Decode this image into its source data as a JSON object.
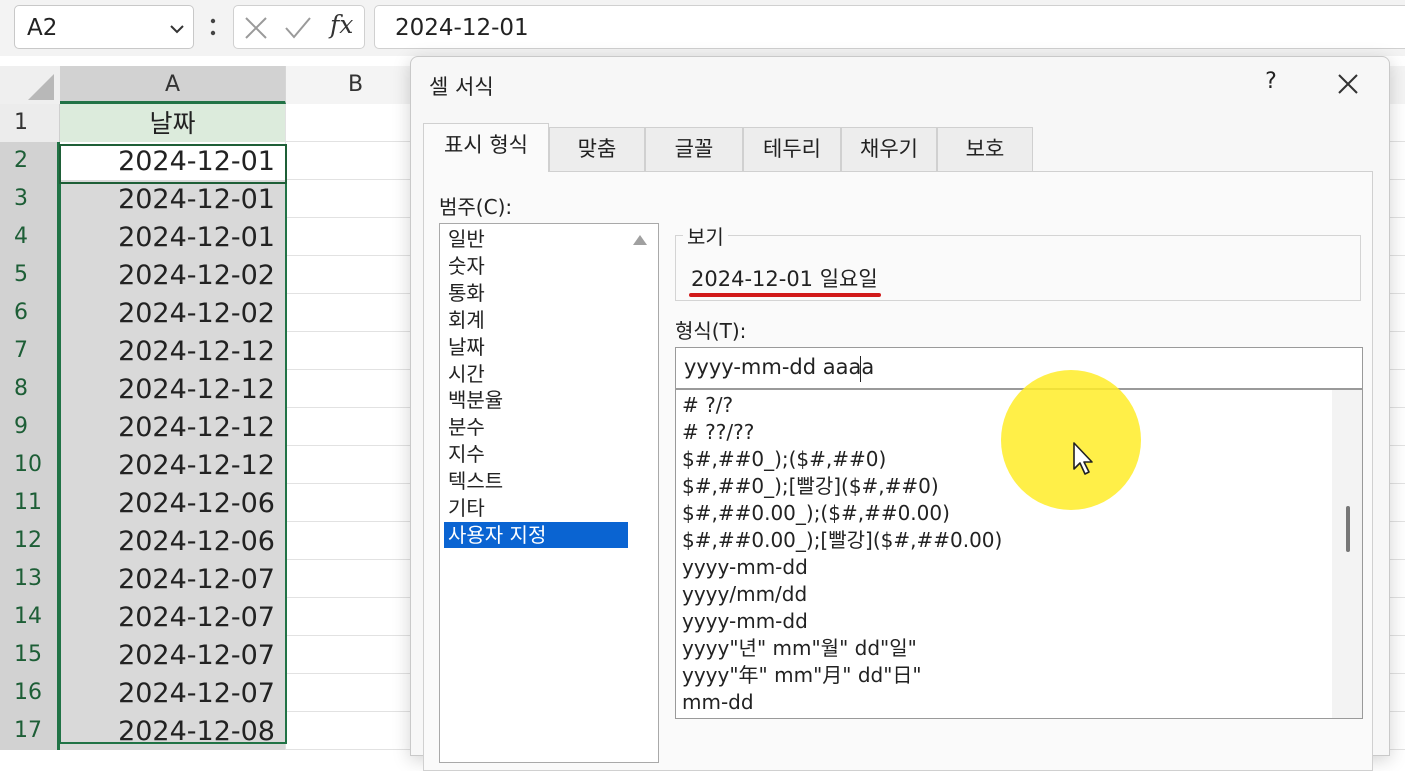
{
  "formula_bar": {
    "name_box": "A2",
    "fx_label": "fx",
    "formula": "2024-12-01"
  },
  "grid": {
    "columns": [
      "A",
      "B"
    ],
    "rows": [
      {
        "num": "1",
        "value": "날짜"
      },
      {
        "num": "2",
        "value": "2024-12-01"
      },
      {
        "num": "3",
        "value": "2024-12-01"
      },
      {
        "num": "4",
        "value": "2024-12-01"
      },
      {
        "num": "5",
        "value": "2024-12-02"
      },
      {
        "num": "6",
        "value": "2024-12-02"
      },
      {
        "num": "7",
        "value": "2024-12-12"
      },
      {
        "num": "8",
        "value": "2024-12-12"
      },
      {
        "num": "9",
        "value": "2024-12-12"
      },
      {
        "num": "10",
        "value": "2024-12-12"
      },
      {
        "num": "11",
        "value": "2024-12-06"
      },
      {
        "num": "12",
        "value": "2024-12-06"
      },
      {
        "num": "13",
        "value": "2024-12-07"
      },
      {
        "num": "14",
        "value": "2024-12-07"
      },
      {
        "num": "15",
        "value": "2024-12-07"
      },
      {
        "num": "16",
        "value": "2024-12-07"
      },
      {
        "num": "17",
        "value": "2024-12-08"
      }
    ]
  },
  "dialog": {
    "title": "셀 서식",
    "help": "?",
    "tabs": [
      "표시 형식",
      "맞춤",
      "글꼴",
      "테두리",
      "채우기",
      "보호"
    ],
    "category_label": "범주(C):",
    "categories": [
      "일반",
      "숫자",
      "통화",
      "회계",
      "날짜",
      "시간",
      "백분율",
      "분수",
      "지수",
      "텍스트",
      "기타",
      "사용자 지정"
    ],
    "selected_category": "사용자 지정",
    "preview_label": "보기",
    "preview_value": "2024-12-01 일요일",
    "format_label": "형식(T):",
    "format_value": "yyyy-mm-dd aaaa",
    "format_types": [
      "# ?/?",
      "# ??/??",
      "$#,##0_);($#,##0)",
      "$#,##0_);[빨강]($#,##0)",
      "$#,##0.00_);($#,##0.00)",
      "$#,##0.00_);[빨강]($#,##0.00)",
      "yyyy-mm-dd",
      "yyyy/mm/dd",
      "yyyy-mm-dd",
      "yyyy\"년\" mm\"월\" dd\"일\"",
      "yyyy\"年\" mm\"月\" dd\"日\"",
      "mm-dd"
    ]
  },
  "colors": {
    "selection_green": "#217346",
    "category_selected": "#0a64d2",
    "preview_underline": "#d11a1a",
    "cursor_highlight": "#ffec28"
  }
}
